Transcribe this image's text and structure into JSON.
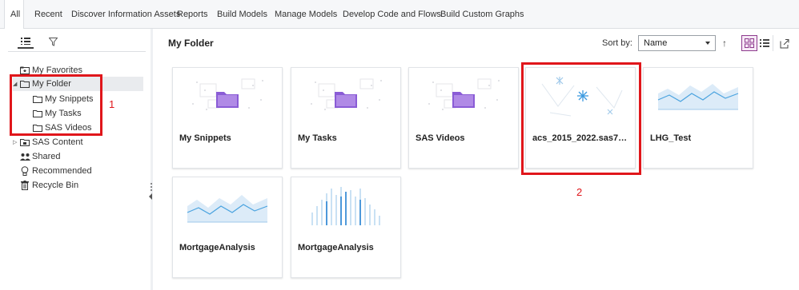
{
  "tabs": [
    "All",
    "Recent",
    "Discover Information Assets",
    "Reports",
    "Build Models",
    "Manage Models",
    "Develop Code and Flows",
    "Build Custom Graphs"
  ],
  "active_tab": "All",
  "left_pane": {
    "tools": {
      "list_icon": "list-icon",
      "filter_icon": "filter-icon"
    },
    "tree": {
      "favorites": "My Favorites",
      "my_folder": "My Folder",
      "snippets": "My Snippets",
      "tasks": "My Tasks",
      "videos": "SAS Videos",
      "sas_content": "SAS Content",
      "shared": "Shared",
      "recommended": "Recommended",
      "recycle_bin": "Recycle Bin"
    },
    "selected": "My Folder"
  },
  "main": {
    "title": "My Folder",
    "sort_label": "Sort by:",
    "sort_value": "Name",
    "sort_direction": "ascending",
    "view_mode": "tiles",
    "cards": {
      "c1": "My Snippets",
      "c2": "My Tasks",
      "c3": "SAS Videos",
      "c4": "acs_2015_2022.sas7b...",
      "c5": "LHG_Test",
      "c6": "MortgageAnalysis",
      "c7": "MortgageAnalysis"
    }
  },
  "annotations": {
    "a1": "1",
    "a2": "2"
  },
  "colors": {
    "accent": "#8e3b8e",
    "folder": "#8a5cd6",
    "chart": "#4aa3df",
    "annotation": "#e0161b"
  }
}
